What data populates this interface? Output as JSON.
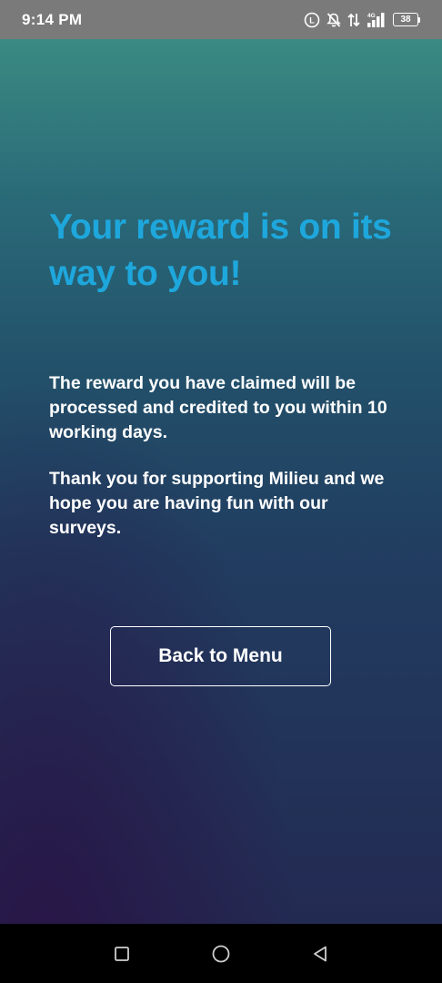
{
  "status_bar": {
    "time": "9:14 PM",
    "network_type": "4G",
    "battery_level": "38"
  },
  "content": {
    "headline": "Your reward is on its way to you!",
    "paragraph_1": "The reward you have claimed will be processed and credited to you within 10 working days.",
    "paragraph_2": "Thank you for supporting Milieu and we hope you are having fun with our surveys.",
    "back_button_label": "Back to Menu"
  },
  "colors": {
    "headline": "#1ea7dc",
    "text": "#ffffff",
    "status_bar": "#7a7a7a",
    "nav_bar": "#000000"
  },
  "icons": {
    "status": [
      "volte-icon",
      "mute-icon",
      "data-arrows-icon",
      "signal-icon",
      "battery-icon"
    ],
    "nav": [
      "recents-square-icon",
      "home-circle-icon",
      "back-triangle-icon"
    ]
  }
}
